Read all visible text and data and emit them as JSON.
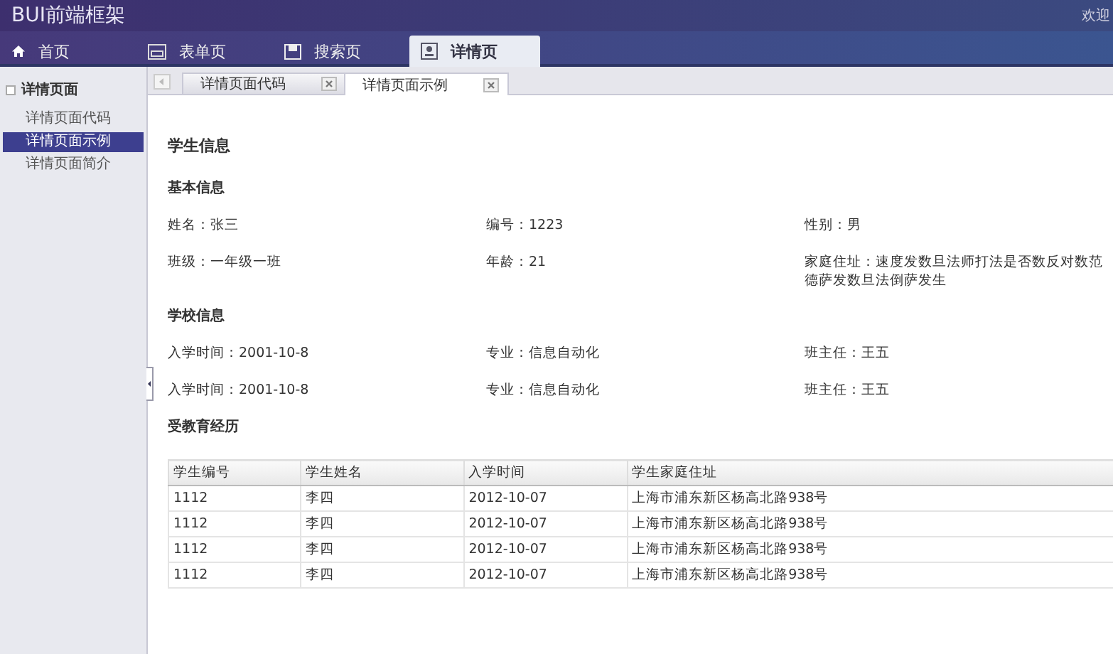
{
  "header": {
    "title": "BUI前端框架",
    "welcome": "欢迎"
  },
  "nav": [
    {
      "label": "首页",
      "selected": false
    },
    {
      "label": "表单页",
      "selected": false
    },
    {
      "label": "搜索页",
      "selected": false
    },
    {
      "label": "详情页",
      "selected": true
    }
  ],
  "sidebar": {
    "title": "详情页面",
    "expanded": true,
    "items": [
      {
        "label": "详情页面代码",
        "selected": false
      },
      {
        "label": "详情页面示例",
        "selected": true
      },
      {
        "label": "详情页面简介",
        "selected": false
      }
    ]
  },
  "tabs": [
    {
      "label": "详情页面代码",
      "selected": false
    },
    {
      "label": "详情页面示例",
      "selected": true
    }
  ],
  "page": {
    "title": "学生信息",
    "sections": [
      {
        "title": "基本信息",
        "rows": [
          [
            "姓名：张三",
            "编号：1223",
            "性别：男"
          ],
          [
            "班级：一年级一班",
            "年龄：21",
            "家庭住址：速度发数旦法师打法是否数反对数范德萨发数旦法倒萨发生"
          ]
        ]
      },
      {
        "title": "学校信息",
        "rows": [
          [
            "入学时间：2001-10-8",
            "专业：信息自动化",
            "班主任：王五"
          ],
          [
            "入学时间：2001-10-8",
            "专业：信息自动化",
            "班主任：王五"
          ]
        ]
      }
    ],
    "table_title": "受教育经历",
    "table": {
      "columns": [
        "学生编号",
        "学生姓名",
        "入学时间",
        "学生家庭住址"
      ],
      "rows": [
        [
          "1112",
          "李四",
          "2012-10-07",
          "上海市浦东新区杨高北路938号"
        ],
        [
          "1112",
          "李四",
          "2012-10-07",
          "上海市浦东新区杨高北路938号"
        ],
        [
          "1112",
          "李四",
          "2012-10-07",
          "上海市浦东新区杨高北路938号"
        ],
        [
          "1112",
          "李四",
          "2012-10-07",
          "上海市浦东新区杨高北路938号"
        ]
      ]
    }
  }
}
